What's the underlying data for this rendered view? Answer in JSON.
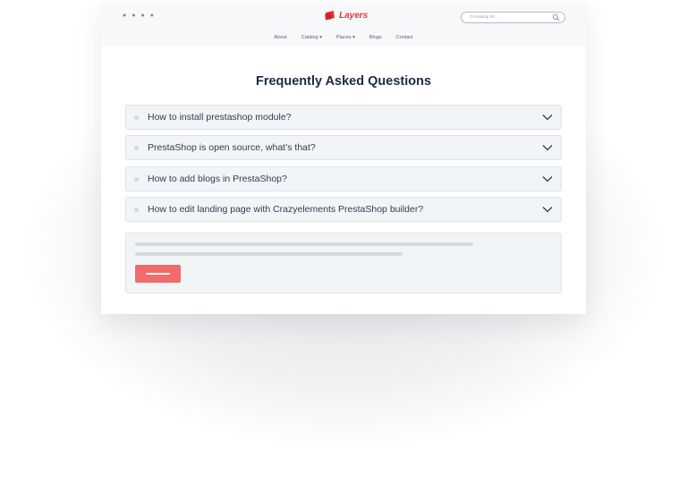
{
  "header": {
    "social_icons": [
      "twitter-icon",
      "facebook-icon",
      "instagram-icon",
      "youtube-icon"
    ],
    "logo": {
      "text": "Layers",
      "color": "#e8323a"
    },
    "search": {
      "placeholder": "I'm looking for..."
    }
  },
  "nav": {
    "items": [
      {
        "label": "About"
      },
      {
        "label": "Catalog",
        "dropdown": true
      },
      {
        "label": "Places",
        "dropdown": true
      },
      {
        "label": "Blogs"
      },
      {
        "label": "Contact"
      }
    ]
  },
  "faq": {
    "title": "Frequently Asked Questions",
    "items": [
      {
        "question": "How to install prestashop module?"
      },
      {
        "question": "PrestaShop is open source, what’s that?"
      },
      {
        "question": "How to add blogs in PrestaShop?"
      },
      {
        "question": "How to edit landing page with Crazyelements PrestaShop builder?"
      }
    ]
  },
  "colors": {
    "accent": "#e8323a",
    "button": "#f26b6b",
    "title": "#1e2a44",
    "card_bg": "#f2f5f8"
  }
}
